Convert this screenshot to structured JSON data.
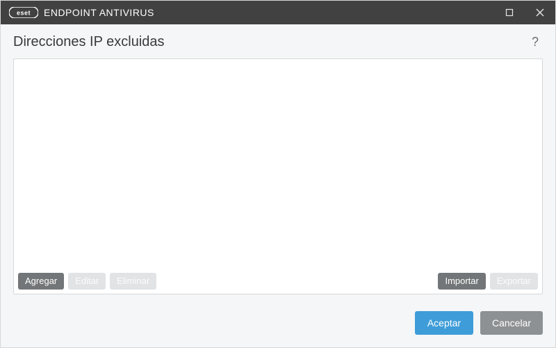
{
  "titlebar": {
    "brand_prefix": "ESET",
    "product": "ENDPOINT ANTIVIRUS"
  },
  "page": {
    "heading": "Direcciones IP excluidas",
    "help_symbol": "?"
  },
  "list": {
    "items": []
  },
  "toolbar": {
    "add": "Agregar",
    "edit": "Editar",
    "remove": "Eliminar",
    "import": "Importar",
    "export": "Exportar"
  },
  "footer": {
    "ok": "Aceptar",
    "cancel": "Cancelar"
  }
}
